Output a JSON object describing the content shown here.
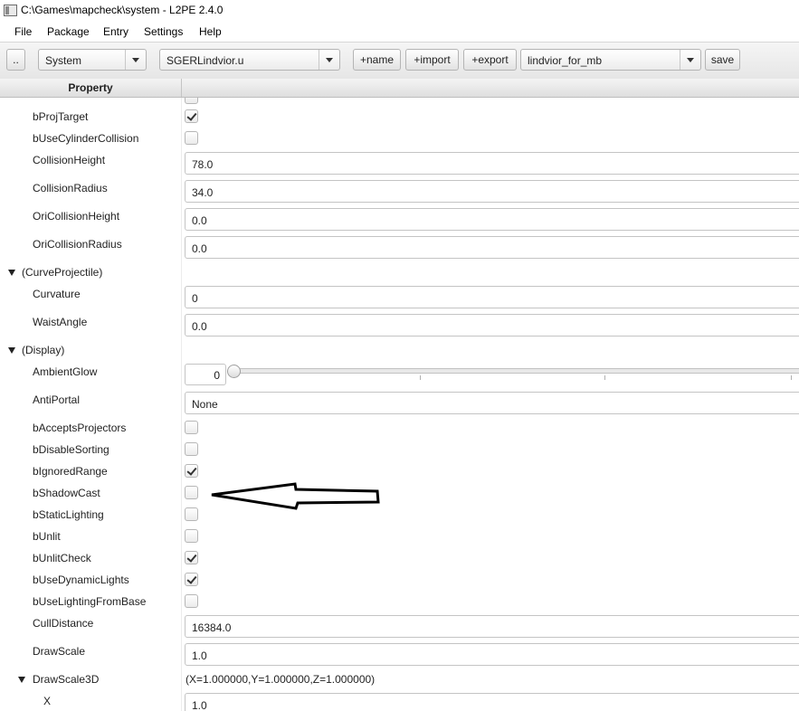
{
  "window": {
    "title": "C:\\Games\\mapcheck\\system - L2PE 2.4.0"
  },
  "menu": [
    "File",
    "Package",
    "Entry",
    "Settings",
    "Help"
  ],
  "toolbar": {
    "browse_label": "..",
    "package_combo": "System",
    "file_combo": "SGERLindvior.u",
    "add_name_label": "+name",
    "add_import_label": "+import",
    "add_export_label": "+export",
    "entry_combo": "lindvior_for_mb",
    "save_label": "save"
  },
  "table": {
    "header": "Property"
  },
  "rows": {
    "partial_top": {
      "checked": false
    },
    "bProjTarget": {
      "label": "bProjTarget",
      "checked": true
    },
    "bUseCylinderCollision": {
      "label": "bUseCylinderCollision",
      "checked": false
    },
    "CollisionHeight": {
      "label": "CollisionHeight",
      "value": "78.0"
    },
    "CollisionRadius": {
      "label": "CollisionRadius",
      "value": "34.0"
    },
    "OriCollisionHeight": {
      "label": "OriCollisionHeight",
      "value": "0.0"
    },
    "OriCollisionRadius": {
      "label": "OriCollisionRadius",
      "value": "0.0"
    },
    "cat_curve": {
      "label": "(CurveProjectile)"
    },
    "Curvature": {
      "label": "Curvature",
      "value": "0"
    },
    "WaistAngle": {
      "label": "WaistAngle",
      "value": "0.0"
    },
    "cat_display": {
      "label": "(Display)"
    },
    "AmbientGlow": {
      "label": "AmbientGlow",
      "value": "0",
      "slider_fraction": 0
    },
    "AntiPortal": {
      "label": "AntiPortal",
      "value": "None"
    },
    "bAcceptsProjectors": {
      "label": "bAcceptsProjectors",
      "checked": false
    },
    "bDisableSorting": {
      "label": "bDisableSorting",
      "checked": false
    },
    "bIgnoredRange": {
      "label": "bIgnoredRange",
      "checked": true
    },
    "bShadowCast": {
      "label": "bShadowCast",
      "checked": false
    },
    "bStaticLighting": {
      "label": "bStaticLighting",
      "checked": false
    },
    "bUnlit": {
      "label": "bUnlit",
      "checked": false
    },
    "bUnlitCheck": {
      "label": "bUnlitCheck",
      "checked": true
    },
    "bUseDynamicLights": {
      "label": "bUseDynamicLights",
      "checked": true
    },
    "bUseLightingFromBase": {
      "label": "bUseLightingFromBase",
      "checked": false
    },
    "CullDistance": {
      "label": "CullDistance",
      "value": "16384.0"
    },
    "DrawScale": {
      "label": "DrawScale",
      "value": "1.0"
    },
    "DrawScale3D": {
      "label": "DrawScale3D",
      "value": "(X=1.000000,Y=1.000000,Z=1.000000)"
    },
    "X": {
      "label": "X",
      "value": "1.0"
    }
  },
  "annotation": {
    "icon": "hand-drawn-arrow-icon"
  }
}
